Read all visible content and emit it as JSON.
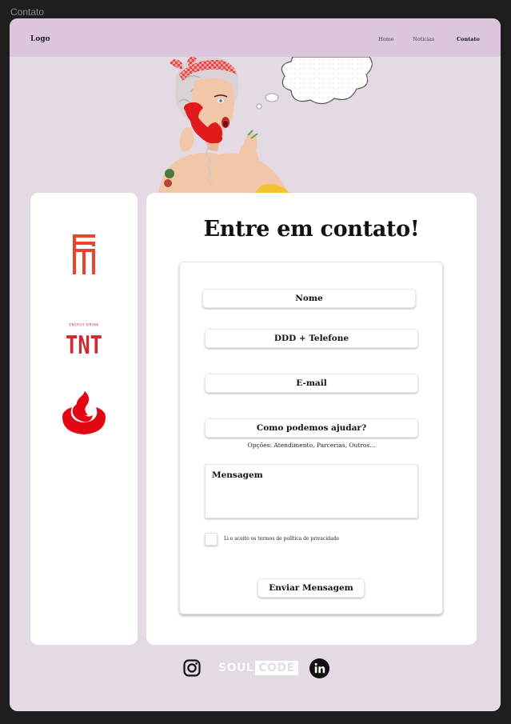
{
  "frame": {
    "title": "Contato"
  },
  "nav": {
    "logo": "Logo",
    "links": [
      "Home",
      "Noticias",
      "Contato"
    ],
    "active": "Contato"
  },
  "partners": [
    {
      "name": "fm-logo",
      "color": "#e8452a"
    },
    {
      "name": "tnt-logo",
      "caption": "ENERGY DRINK",
      "text": "TNT",
      "color": "#d02a31"
    },
    {
      "name": "santander-logo",
      "color": "#e30613"
    }
  ],
  "form": {
    "title": "Entre em contato!",
    "name_placeholder": "Nome",
    "phone_placeholder": "DDD + Telefone",
    "email_placeholder": "E-mail",
    "help_placeholder": "Como podemos ajudar?",
    "help_hint": "Opções: Atendimento, Parcerias, Outros...",
    "message_placeholder": "Mensagem",
    "terms_label": "Li e aceito os termos de política de privacidade",
    "submit_label": "Enviar Mensagem"
  },
  "footer": {
    "brand_left": "SOUL",
    "brand_right": "CODE",
    "icons": [
      "instagram-icon",
      "soulcode-logo",
      "linkedin-icon"
    ]
  },
  "colors": {
    "page_bg": "#e4dae4",
    "navbar_bg": "#dcc6de",
    "card_bg": "#ffffff",
    "canvas_bg": "#1e1e1e"
  }
}
